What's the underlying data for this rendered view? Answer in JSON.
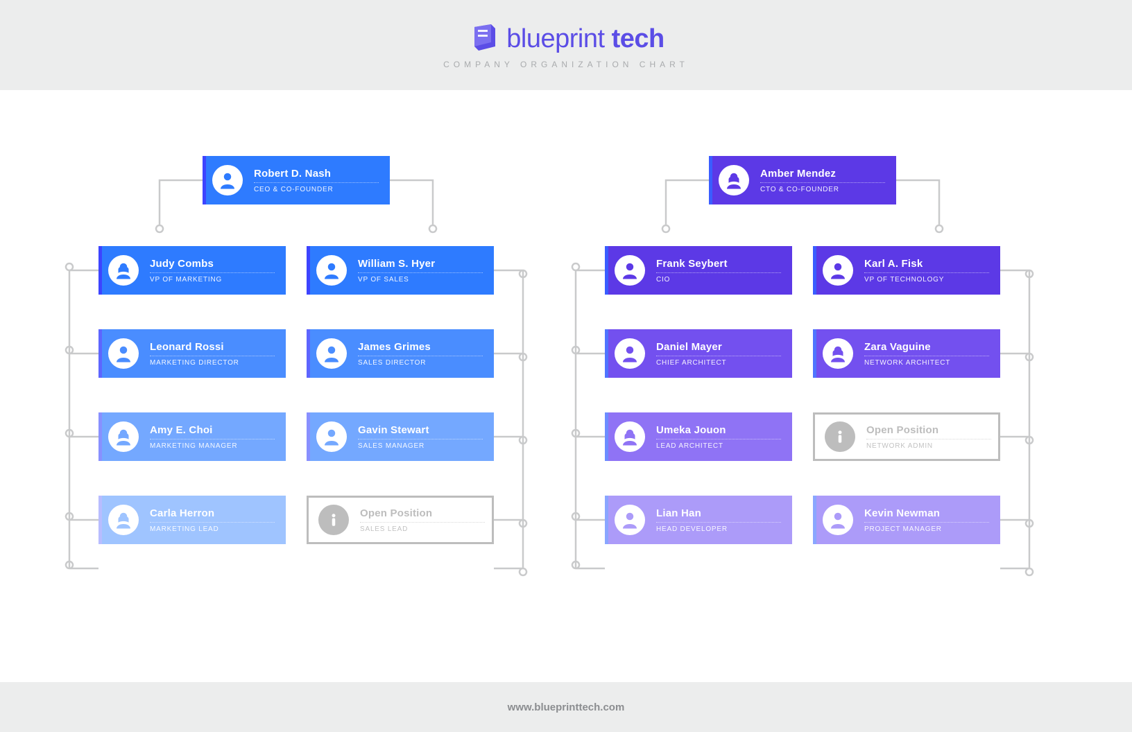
{
  "brand": {
    "word1": "blueprint",
    "word2": "tech"
  },
  "subtitle": "COMPANY ORGANIZATION CHART",
  "footer": "www.blueprinttech.com",
  "colors": {
    "blue1": "#2e7bff",
    "blue1a": "#3d44ff",
    "blue2": "#4a8dff",
    "blue2a": "#5d65ff",
    "blue3": "#74a8ff",
    "blue3a": "#8890ff",
    "blue4": "#9fc4ff",
    "blue4a": "#b8bcff",
    "purple1": "#5c39e6",
    "purple1a": "#3a5dff",
    "purple2": "#7350ef",
    "purple2a": "#4f74ff",
    "purple3": "#8f73f5",
    "purple3a": "#6c8dff",
    "purple4": "#ac9bf9",
    "purple4a": "#8aa6ff"
  },
  "cards": {
    "ceo": {
      "name": "Robert D. Nash",
      "title": "CEO & CO-FOUNDER",
      "gender": "m"
    },
    "cto": {
      "name": "Amber Mendez",
      "title": "CTO & CO-FOUNDER",
      "gender": "f"
    },
    "l1a": {
      "name": "Judy Combs",
      "title": "VP OF MARKETING",
      "gender": "f"
    },
    "l1b": {
      "name": "William S. Hyer",
      "title": "VP OF SALES",
      "gender": "m"
    },
    "l2a": {
      "name": "Leonard Rossi",
      "title": "MARKETING DIRECTOR",
      "gender": "m"
    },
    "l2b": {
      "name": "James Grimes",
      "title": "SALES DIRECTOR",
      "gender": "m"
    },
    "l3a": {
      "name": "Amy E. Choi",
      "title": "MARKETING MANAGER",
      "gender": "f"
    },
    "l3b": {
      "name": "Gavin Stewart",
      "title": "SALES MANAGER",
      "gender": "m"
    },
    "l4a": {
      "name": "Carla Herron",
      "title": "MARKETING LEAD",
      "gender": "f"
    },
    "l4b": {
      "name": "Open Position",
      "title": "SALES LEAD",
      "gender": "open"
    },
    "r1a": {
      "name": "Frank Seybert",
      "title": "CIO",
      "gender": "m"
    },
    "r1b": {
      "name": "Karl A. Fisk",
      "title": "VP OF TECHNOLOGY",
      "gender": "m"
    },
    "r2a": {
      "name": "Daniel Mayer",
      "title": "CHIEF ARCHITECT",
      "gender": "m"
    },
    "r2b": {
      "name": "Zara Vaguine",
      "title": "NETWORK ARCHITECT",
      "gender": "f"
    },
    "r3a": {
      "name": "Umeka Jouon",
      "title": "LEAD ARCHITECT",
      "gender": "f"
    },
    "r3b": {
      "name": "Open Position",
      "title": "NETWORK ADMIN",
      "gender": "open"
    },
    "r4a": {
      "name": "Lian Han",
      "title": "HEAD DEVELOPER",
      "gender": "m"
    },
    "r4b": {
      "name": "Kevin Newman",
      "title": "PROJECT MANAGER",
      "gender": "m"
    }
  }
}
